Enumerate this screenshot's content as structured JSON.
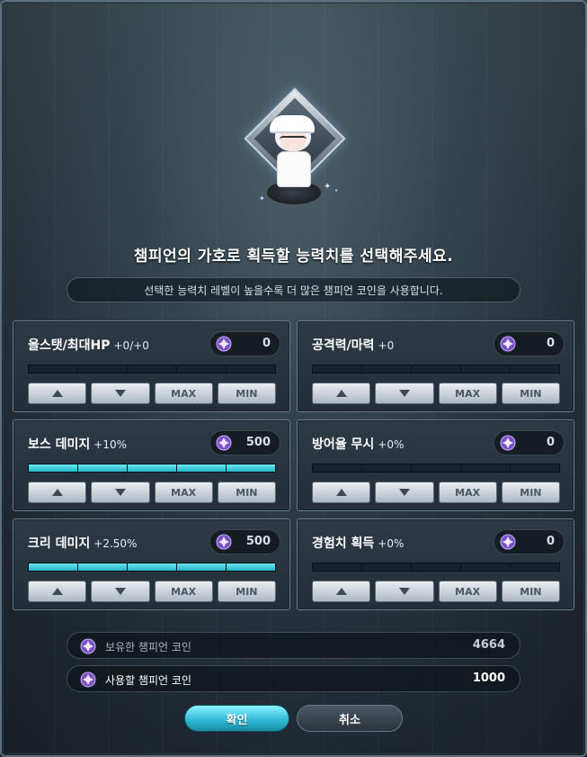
{
  "header": {
    "title": "챔피언의 가호로 획득할 능력치를 선택해주세요.",
    "subtitle": "선택한 능력치 레벨이 높을수록 더 많은 챔피언 코인을 사용합니다."
  },
  "buttons": {
    "up": "up-arrow",
    "down": "down-arrow",
    "max": "MAX",
    "min": "MIN"
  },
  "stats": [
    {
      "name": "올스탯/최대HP",
      "bonus": "+0/+0",
      "coins": "0",
      "level_segments_filled": 0,
      "total_segments": 5
    },
    {
      "name": "공격력/마력",
      "bonus": "+0",
      "coins": "0",
      "level_segments_filled": 0,
      "total_segments": 5
    },
    {
      "name": "보스 데미지",
      "bonus": "+10%",
      "coins": "500",
      "level_segments_filled": 5,
      "total_segments": 5
    },
    {
      "name": "방어율 무시",
      "bonus": "+0%",
      "coins": "0",
      "level_segments_filled": 0,
      "total_segments": 5
    },
    {
      "name": "크리 데미지",
      "bonus": "+2.50%",
      "coins": "500",
      "level_segments_filled": 5,
      "total_segments": 5
    },
    {
      "name": "경험치 획득",
      "bonus": "+0%",
      "coins": "0",
      "level_segments_filled": 0,
      "total_segments": 5
    }
  ],
  "summary": {
    "owned_label": "보유한 챔피언 코인",
    "owned_value": "4664",
    "use_label": "사용할 챔피언 코인",
    "use_value": "1000"
  },
  "actions": {
    "confirm": "확인",
    "cancel": "취소"
  },
  "colors": {
    "accent": "#2cb7d3",
    "coin": "#9b6bd8"
  }
}
